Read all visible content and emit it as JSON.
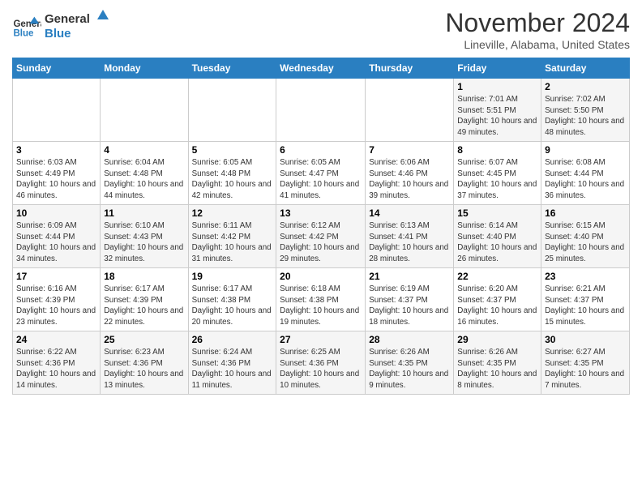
{
  "logo": {
    "line1": "General",
    "line2": "Blue"
  },
  "header": {
    "title": "November 2024",
    "subtitle": "Lineville, Alabama, United States"
  },
  "weekdays": [
    "Sunday",
    "Monday",
    "Tuesday",
    "Wednesday",
    "Thursday",
    "Friday",
    "Saturday"
  ],
  "weeks": [
    [
      {
        "day": "",
        "info": ""
      },
      {
        "day": "",
        "info": ""
      },
      {
        "day": "",
        "info": ""
      },
      {
        "day": "",
        "info": ""
      },
      {
        "day": "",
        "info": ""
      },
      {
        "day": "1",
        "info": "Sunrise: 7:01 AM\nSunset: 5:51 PM\nDaylight: 10 hours and 49 minutes."
      },
      {
        "day": "2",
        "info": "Sunrise: 7:02 AM\nSunset: 5:50 PM\nDaylight: 10 hours and 48 minutes."
      }
    ],
    [
      {
        "day": "3",
        "info": "Sunrise: 6:03 AM\nSunset: 4:49 PM\nDaylight: 10 hours and 46 minutes."
      },
      {
        "day": "4",
        "info": "Sunrise: 6:04 AM\nSunset: 4:48 PM\nDaylight: 10 hours and 44 minutes."
      },
      {
        "day": "5",
        "info": "Sunrise: 6:05 AM\nSunset: 4:48 PM\nDaylight: 10 hours and 42 minutes."
      },
      {
        "day": "6",
        "info": "Sunrise: 6:05 AM\nSunset: 4:47 PM\nDaylight: 10 hours and 41 minutes."
      },
      {
        "day": "7",
        "info": "Sunrise: 6:06 AM\nSunset: 4:46 PM\nDaylight: 10 hours and 39 minutes."
      },
      {
        "day": "8",
        "info": "Sunrise: 6:07 AM\nSunset: 4:45 PM\nDaylight: 10 hours and 37 minutes."
      },
      {
        "day": "9",
        "info": "Sunrise: 6:08 AM\nSunset: 4:44 PM\nDaylight: 10 hours and 36 minutes."
      }
    ],
    [
      {
        "day": "10",
        "info": "Sunrise: 6:09 AM\nSunset: 4:44 PM\nDaylight: 10 hours and 34 minutes."
      },
      {
        "day": "11",
        "info": "Sunrise: 6:10 AM\nSunset: 4:43 PM\nDaylight: 10 hours and 32 minutes."
      },
      {
        "day": "12",
        "info": "Sunrise: 6:11 AM\nSunset: 4:42 PM\nDaylight: 10 hours and 31 minutes."
      },
      {
        "day": "13",
        "info": "Sunrise: 6:12 AM\nSunset: 4:42 PM\nDaylight: 10 hours and 29 minutes."
      },
      {
        "day": "14",
        "info": "Sunrise: 6:13 AM\nSunset: 4:41 PM\nDaylight: 10 hours and 28 minutes."
      },
      {
        "day": "15",
        "info": "Sunrise: 6:14 AM\nSunset: 4:40 PM\nDaylight: 10 hours and 26 minutes."
      },
      {
        "day": "16",
        "info": "Sunrise: 6:15 AM\nSunset: 4:40 PM\nDaylight: 10 hours and 25 minutes."
      }
    ],
    [
      {
        "day": "17",
        "info": "Sunrise: 6:16 AM\nSunset: 4:39 PM\nDaylight: 10 hours and 23 minutes."
      },
      {
        "day": "18",
        "info": "Sunrise: 6:17 AM\nSunset: 4:39 PM\nDaylight: 10 hours and 22 minutes."
      },
      {
        "day": "19",
        "info": "Sunrise: 6:17 AM\nSunset: 4:38 PM\nDaylight: 10 hours and 20 minutes."
      },
      {
        "day": "20",
        "info": "Sunrise: 6:18 AM\nSunset: 4:38 PM\nDaylight: 10 hours and 19 minutes."
      },
      {
        "day": "21",
        "info": "Sunrise: 6:19 AM\nSunset: 4:37 PM\nDaylight: 10 hours and 18 minutes."
      },
      {
        "day": "22",
        "info": "Sunrise: 6:20 AM\nSunset: 4:37 PM\nDaylight: 10 hours and 16 minutes."
      },
      {
        "day": "23",
        "info": "Sunrise: 6:21 AM\nSunset: 4:37 PM\nDaylight: 10 hours and 15 minutes."
      }
    ],
    [
      {
        "day": "24",
        "info": "Sunrise: 6:22 AM\nSunset: 4:36 PM\nDaylight: 10 hours and 14 minutes."
      },
      {
        "day": "25",
        "info": "Sunrise: 6:23 AM\nSunset: 4:36 PM\nDaylight: 10 hours and 13 minutes."
      },
      {
        "day": "26",
        "info": "Sunrise: 6:24 AM\nSunset: 4:36 PM\nDaylight: 10 hours and 11 minutes."
      },
      {
        "day": "27",
        "info": "Sunrise: 6:25 AM\nSunset: 4:36 PM\nDaylight: 10 hours and 10 minutes."
      },
      {
        "day": "28",
        "info": "Sunrise: 6:26 AM\nSunset: 4:35 PM\nDaylight: 10 hours and 9 minutes."
      },
      {
        "day": "29",
        "info": "Sunrise: 6:26 AM\nSunset: 4:35 PM\nDaylight: 10 hours and 8 minutes."
      },
      {
        "day": "30",
        "info": "Sunrise: 6:27 AM\nSunset: 4:35 PM\nDaylight: 10 hours and 7 minutes."
      }
    ]
  ]
}
